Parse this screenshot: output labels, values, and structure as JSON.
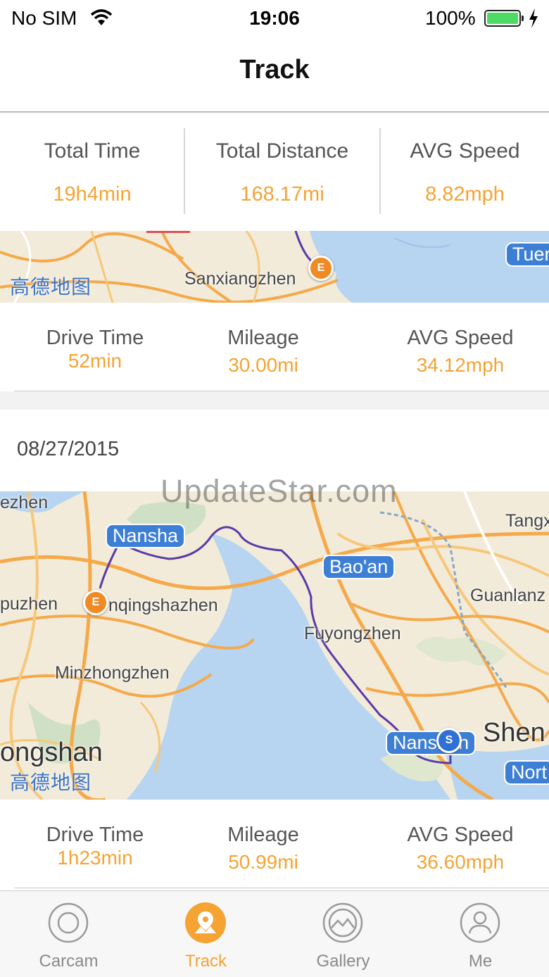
{
  "status_bar": {
    "carrier": "No SIM",
    "time": "19:06",
    "battery": "100%"
  },
  "nav": {
    "title": "Track"
  },
  "summary": [
    {
      "label": "Total Time",
      "value": "19h4min"
    },
    {
      "label": "Total Distance",
      "value": "168.17mi"
    },
    {
      "label": "AVG Speed",
      "value": "8.82mph"
    }
  ],
  "trips": [
    {
      "map": {
        "labels": [
          "Sanxiangzhen"
        ],
        "badges": [
          "Tuer"
        ],
        "logo": "高德地图",
        "markers": [
          "E"
        ]
      },
      "stats": [
        {
          "label": "Drive Time",
          "value": "52min"
        },
        {
          "label": "Mileage",
          "value": "30.00mi"
        },
        {
          "label": "AVG Speed",
          "value": "34.12mph"
        }
      ]
    },
    {
      "date": "08/27/2015",
      "map": {
        "labels": [
          "ezhen",
          "Tangx",
          "Guanlanz",
          "puzhen",
          "nqingshazhen",
          "Fuyongzhen",
          "Minzhongzhen",
          "ongshan",
          "Shen"
        ],
        "badges": [
          "Nansha",
          "Bao'an",
          "Nanshan",
          "Nort"
        ],
        "logo": "高德地图",
        "markers": [
          "E",
          "S"
        ]
      },
      "stats": [
        {
          "label": "Drive Time",
          "value": "1h23min"
        },
        {
          "label": "Mileage",
          "value": "50.99mi"
        },
        {
          "label": "AVG Speed",
          "value": "36.60mph"
        }
      ]
    }
  ],
  "watermark": "UpdateStar.com",
  "tabs": [
    {
      "label": "Carcam",
      "icon": "camera-lens-icon"
    },
    {
      "label": "Track",
      "icon": "map-pin-icon",
      "active": true
    },
    {
      "label": "Gallery",
      "icon": "gallery-icon"
    },
    {
      "label": "Me",
      "icon": "person-icon"
    }
  ],
  "colors": {
    "accent": "#f5a333",
    "route": "#5a3aa8",
    "map_water": "#b7d4f0",
    "map_land": "#f2ebd9",
    "map_badge": "#3e7fd6"
  }
}
